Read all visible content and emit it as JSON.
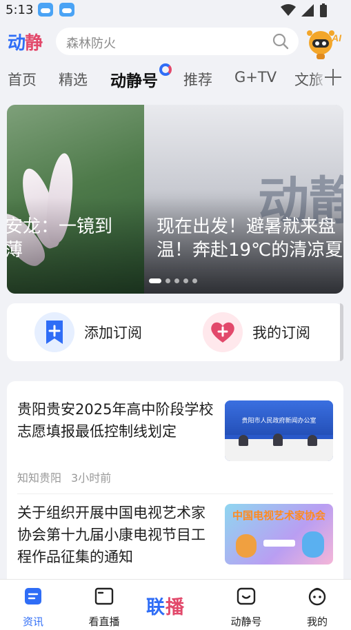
{
  "status": {
    "time": "5:13"
  },
  "header": {
    "logo_part1": "动",
    "logo_part2": "静",
    "search_placeholder": "森林防火"
  },
  "tabs": [
    {
      "label": "首页",
      "active": false
    },
    {
      "label": "精选",
      "active": false
    },
    {
      "label": "动静号",
      "active": true
    },
    {
      "label": "推荐",
      "active": false
    },
    {
      "label": "G+TV",
      "active": false
    },
    {
      "label": "文旅",
      "active": false
    }
  ],
  "carousel": {
    "left_caption_line1": "安龙：一镜到",
    "left_caption_line2": "薄",
    "right_caption_line1": "现在出发！避暑就来盘",
    "right_caption_line2": "温！奔赴19℃的清凉夏",
    "watermark": "动静",
    "slide_count": 5,
    "active_index": 0
  },
  "subscribe": {
    "add_label": "添加订阅",
    "mine_label": "我的订阅"
  },
  "news": [
    {
      "title": "贵阳贵安2025年高中阶段学校志愿填报最低控制线划定",
      "source": "知知贵阳",
      "time": "3小时前",
      "thumb_text": "贵阳市人民政府新闻办公室"
    },
    {
      "title": "关于组织开展中国电视艺术家协会第十九届小康电视节目工程作品征集的通知",
      "thumb_text": "中国电视艺术家协会"
    }
  ],
  "bottom_nav": {
    "news": "资讯",
    "live": "看直播",
    "center_part1": "联",
    "center_part2": "播",
    "dongjing": "动静号",
    "mine": "我的"
  },
  "colors": {
    "brand_blue": "#2f6df6",
    "brand_pink": "#e2496b"
  }
}
